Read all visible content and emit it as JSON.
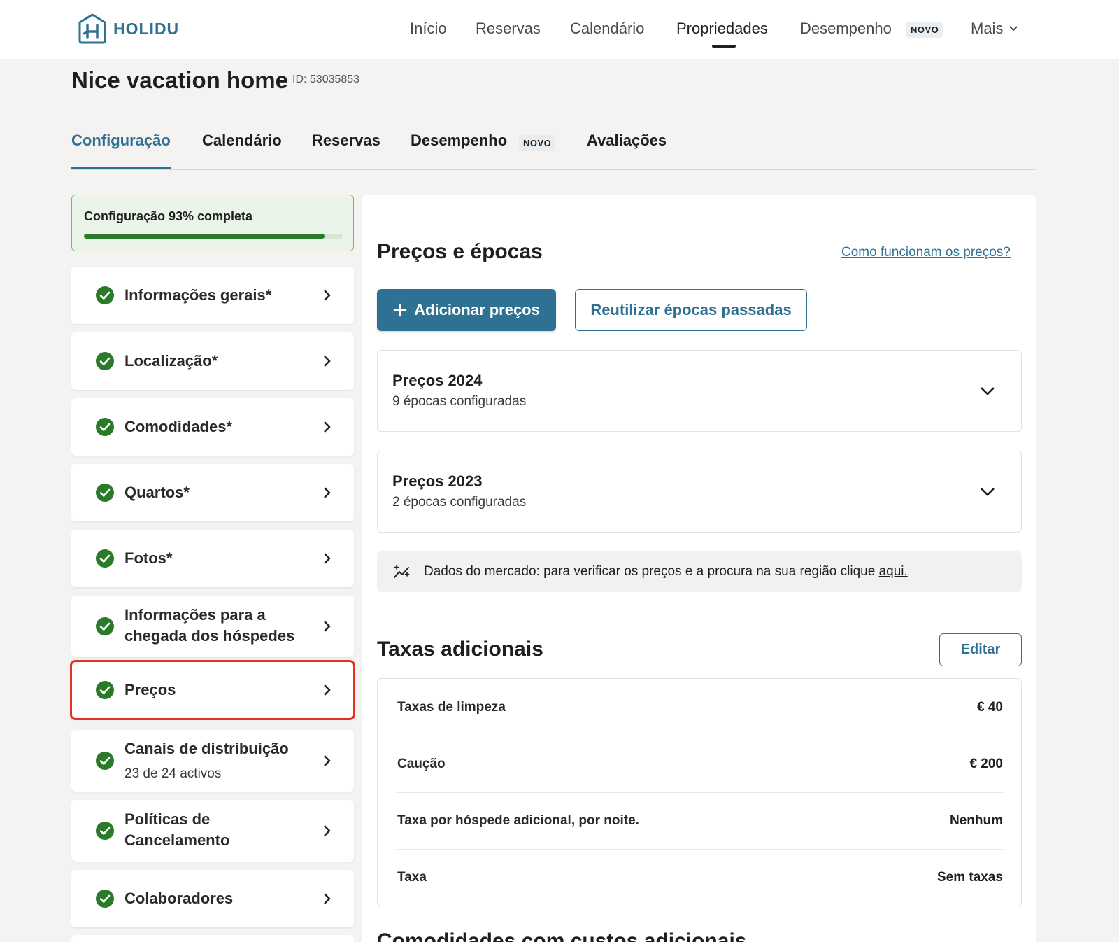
{
  "brand": {
    "name": "HOLIDU",
    "color": "#2f7192"
  },
  "nav": {
    "items": [
      "Início",
      "Reservas",
      "Calendário",
      "Propriedades",
      "Desempenho"
    ],
    "active": "Propriedades",
    "new_badge": "NOVO",
    "more_label": "Mais"
  },
  "property": {
    "title": "Nice vacation home",
    "id_label": "ID: 53035853"
  },
  "tabs": {
    "items": [
      "Configuração",
      "Calendário",
      "Reservas",
      "Desempenho",
      "Avaliações"
    ],
    "active": "Configuração",
    "new_badge": "NOVO"
  },
  "setup": {
    "progress_label": "Configuração 93% completa",
    "progress_percent": 93
  },
  "sidebar": {
    "items": [
      {
        "label": "Informações gerais*",
        "status": "complete"
      },
      {
        "label": "Localização*",
        "status": "complete"
      },
      {
        "label": "Comodidades*",
        "status": "complete"
      },
      {
        "label": "Quartos*",
        "status": "complete"
      },
      {
        "label": "Fotos*",
        "status": "complete"
      },
      {
        "label": "Informações para a chegada dos hóspedes",
        "status": "complete"
      },
      {
        "label": "Preços",
        "status": "complete",
        "selected": true
      },
      {
        "label": "Canais de distribuição",
        "sub": "23 de 24 activos",
        "status": "complete"
      },
      {
        "label": "Políticas de Cancelamento",
        "status": "complete"
      },
      {
        "label": "Colaboradores",
        "status": "complete"
      }
    ]
  },
  "pricing": {
    "title": "Preços e épocas",
    "help_link": "Como funcionam os preços?",
    "add_button": "Adicionar preços",
    "reuse_button": "Reutilizar épocas passadas",
    "seasons": [
      {
        "title": "Preços 2024",
        "count": "9 épocas configuradas"
      },
      {
        "title": "Preços 2023",
        "count": "2 épocas configuradas"
      }
    ],
    "market_text": "Dados do mercado: para verificar os preços e a procura na sua região clique ",
    "market_link": "aqui."
  },
  "fees": {
    "title": "Taxas adicionais",
    "edit_button": "Editar",
    "rows": [
      {
        "name": "Taxas de limpeza",
        "value": "€ 40"
      },
      {
        "name": "Caução",
        "value": "€ 200"
      },
      {
        "name": "Taxa por hóspede adicional, por noite.",
        "value": "Nenhum"
      },
      {
        "name": "Taxa",
        "value": "Sem taxas"
      }
    ]
  },
  "next_section_title": "Comodidades com custos adicionais"
}
